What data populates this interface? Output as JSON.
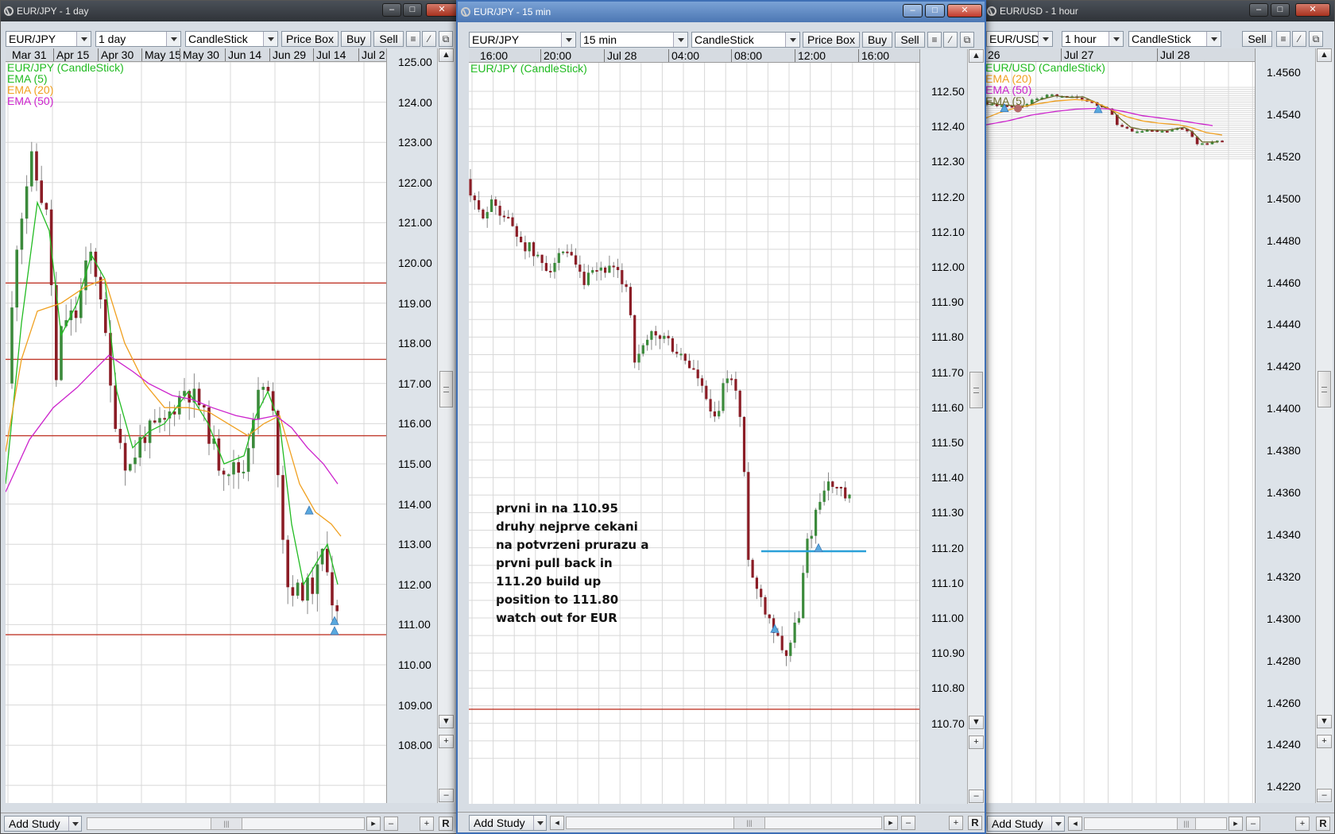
{
  "colors": {
    "bull": "#3b8a3b",
    "bear": "#8b1d26",
    "ema5": "#22bb22",
    "ema20": "#f0a020",
    "ema50": "#cc22cc",
    "ema5_usd": "#6b6b2a",
    "level": "#c0392b",
    "trend": "#2aa0d8",
    "marker": "#59a8de",
    "exit": "#b46a6a",
    "grid": "#d8d8d8"
  },
  "windows": {
    "left": {
      "title": "EUR/JPY - 1 day",
      "symbol": "EUR/JPY",
      "timeframe": "1 day",
      "chart_type": "CandleStick",
      "buttons": {
        "price_box": "Price Box",
        "buy": "Buy",
        "sell": "Sell"
      },
      "dates": [
        "Mar 31",
        "Apr 15",
        "Apr 30",
        "May 15",
        "May 30",
        "Jun 14",
        "Jun 29",
        "Jul 14",
        "Jul 2"
      ],
      "legend": [
        {
          "label": "EUR/JPY (CandleStick)",
          "color": "#22bb22"
        },
        {
          "label": "EMA (5)",
          "color": "#22bb22"
        },
        {
          "label": "EMA (20)",
          "color": "#f0a020"
        },
        {
          "label": "EMA (50)",
          "color": "#cc22cc"
        }
      ],
      "y_labels": [
        "125.00",
        "124.00",
        "123.00",
        "122.00",
        "121.00",
        "120.00",
        "119.00",
        "118.00",
        "117.00",
        "116.00",
        "115.00",
        "114.00",
        "113.00",
        "112.00",
        "111.00",
        "110.00",
        "109.00",
        "108.00"
      ],
      "add_study": "Add Study"
    },
    "middle": {
      "title": "EUR/JPY - 15 min",
      "symbol": "EUR/JPY",
      "timeframe": "15 min",
      "chart_type": "CandleStick",
      "buttons": {
        "price_box": "Price Box",
        "buy": "Buy",
        "sell": "Sell"
      },
      "dates": [
        "16:00",
        "20:00",
        "Jul 28",
        "04:00",
        "08:00",
        "12:00",
        "16:00"
      ],
      "legend": [
        {
          "label": "EUR/JPY (CandleStick)",
          "color": "#22bb22"
        }
      ],
      "y_labels": [
        "112.50",
        "112.40",
        "112.30",
        "112.20",
        "112.10",
        "112.00",
        "111.90",
        "111.80",
        "111.70",
        "111.60",
        "111.50",
        "111.40",
        "111.30",
        "111.20",
        "111.10",
        "111.00",
        "110.90",
        "110.80",
        "110.70"
      ],
      "note": "prvni in na 110.95\ndruhy nejprve cekani\nna potvrzeni prurazu a\nprvni pull back in\n111.20 build up\nposition to 111.80\nwatch out for EUR",
      "add_study": "Add Study"
    },
    "right": {
      "title": "EUR/USD - 1 hour",
      "symbol": "EUR/USD",
      "timeframe": "1 hour",
      "chart_type": "CandleStick",
      "buttons": {
        "sell": "Sell"
      },
      "dates": [
        "26",
        "Jul 27",
        "Jul 28"
      ],
      "legend": [
        {
          "label": "EUR/USD (CandleStick)",
          "color": "#22bb22"
        },
        {
          "label": "EMA (20)",
          "color": "#f0a020"
        },
        {
          "label": "EMA (50)",
          "color": "#cc22cc"
        },
        {
          "label": "EMA (5)",
          "color": "#6b6b2a"
        }
      ],
      "y_labels": [
        "1.4560",
        "1.4540",
        "1.4520",
        "1.4500",
        "1.4480",
        "1.4460",
        "1.4440",
        "1.4420",
        "1.4400",
        "1.4380",
        "1.4360",
        "1.4340",
        "1.4320",
        "1.4300",
        "1.4280",
        "1.4260",
        "1.4240",
        "1.4220"
      ],
      "add_study": "Add Study"
    }
  }
}
